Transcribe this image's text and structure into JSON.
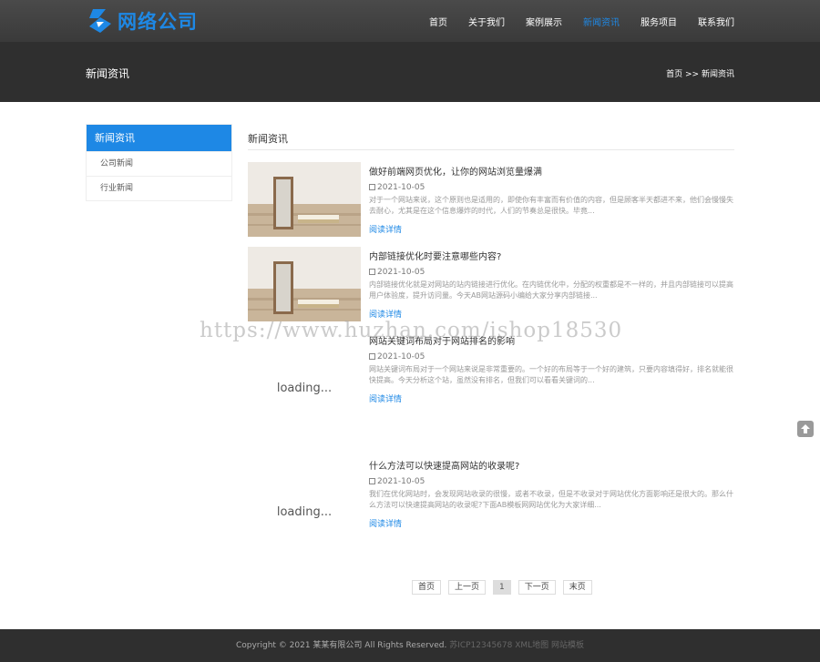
{
  "brand": {
    "name": "网络公司",
    "accent": "#1e88e5"
  },
  "nav": {
    "items": [
      {
        "label": "首页"
      },
      {
        "label": "关于我们"
      },
      {
        "label": "案例展示"
      },
      {
        "label": "新闻资讯"
      },
      {
        "label": "服务项目"
      },
      {
        "label": "联系我们"
      }
    ],
    "active": "新闻资讯"
  },
  "banner": {
    "title": "新闻资讯",
    "breadcrumb_home": "首页",
    "breadcrumb_sep": ">>",
    "breadcrumb_current": "新闻资讯"
  },
  "sidebar": {
    "heading": "新闻资讯",
    "items": [
      {
        "label": "公司新闻"
      },
      {
        "label": "行业新闻"
      }
    ]
  },
  "main": {
    "section_title": "新闻资讯",
    "articles": [
      {
        "title": "做好前端网页优化，让你的网站浏览量爆满",
        "date": "2021-10-05",
        "desc": "对于一个网站来说，这个原则也是适用的，即使你有丰富而有价值的内容，但是顾客半天都进不来，他们会慢慢失去耐心，尤其是在这个信息爆炸的时代，人们的节奏总是很快。毕竟...",
        "more": "阅读详情",
        "thumb": "image"
      },
      {
        "title": "内部链接优化时要注意哪些内容?",
        "date": "2021-10-05",
        "desc": "内部链接优化就是对网站的站内链接进行优化。在内链优化中，分配的权重都是不一样的，并且内部链接可以提高用户体验度，提升访问量。今天AB网站源码小编给大家分享内部链接...",
        "more": "阅读详情",
        "thumb": "image"
      },
      {
        "title": "网站关键词布局对于网站排名的影响",
        "date": "2021-10-05",
        "desc": "网站关键词布局对于一个网站来说是非常重要的。一个好的布局等于一个好的建筑，只要内容填得好，排名就能很快提高。今天分析这个站，虽然没有排名，但我们可以看看关键词的...",
        "more": "阅读详情",
        "thumb": "loading...",
        "loading_text": "loading..."
      },
      {
        "title": "什么方法可以快速提高网站的收录呢?",
        "date": "2021-10-05",
        "desc": "我们在优化网站时，会发现网站收录的很慢，或者不收录，但是不收录对于网站优化方面影响还是很大的。那么什么方法可以快速提高网站的收录呢?下面AB模板网网站优化为大家详细...",
        "more": "阅读详情",
        "thumb": "loading...",
        "loading_text": "loading..."
      }
    ]
  },
  "pagination": {
    "items": [
      {
        "label": "首页"
      },
      {
        "label": "上一页"
      },
      {
        "label": "1"
      },
      {
        "label": "下一页"
      },
      {
        "label": "末页"
      }
    ],
    "current": "1"
  },
  "watermark": "https://www.huzhan.com/ishop18530",
  "footer": {
    "copyright": "Copyright © 2021 某某有限公司 All Rights Reserved.",
    "links": "苏ICP12345678 XML地图 网站模板"
  }
}
